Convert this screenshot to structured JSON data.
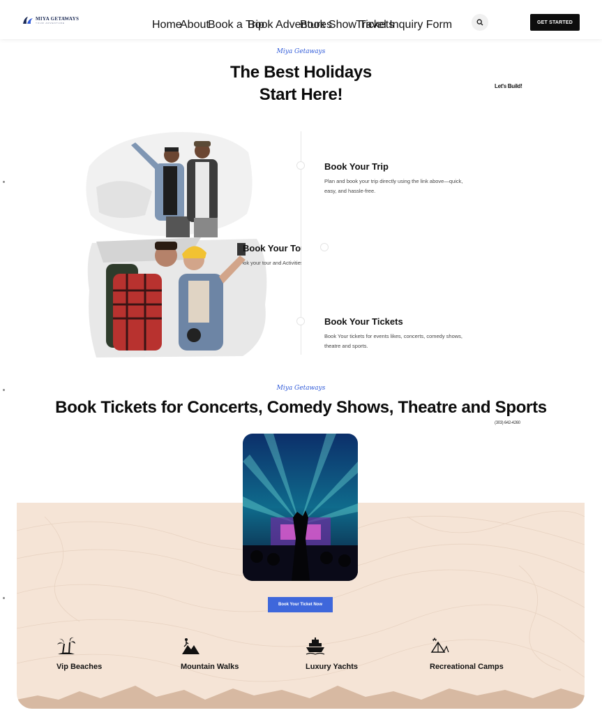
{
  "header": {
    "logo_text": "MIYA GETAWAYS",
    "logo_sub": "YOUR ADVENTURE",
    "nav": [
      "Home",
      "About",
      "Book a Trip",
      "Book Adventures",
      "Book Show Tickets",
      "Travel Inquiry Form"
    ],
    "call_title": "Let's Build!",
    "call_phone": "(303) 642-4260",
    "cta_label": "GET STARTED",
    "search_icon": "search-icon"
  },
  "hero": {
    "script": "Miya Getaways",
    "title_line1": "The Best Holidays",
    "title_line2": "Start Here!",
    "steps": [
      {
        "title": "Book Your Trip",
        "text": "Plan and book your trip directly using the link above—quick, easy, and hassle-free."
      },
      {
        "title": "Book Your Tour",
        "text": "Book your tour and Activities"
      },
      {
        "title": "Book Your Tickets",
        "text": "Book Your tickets for events likes, concerts, comedy shows, theatre and sports."
      }
    ]
  },
  "tickets": {
    "script": "Miya Getaways",
    "title": "Book Tickets for Concerts, Comedy Shows, Theatre and Sports",
    "button": "Book Your Ticket Now"
  },
  "features": [
    {
      "label": "Vip Beaches",
      "icon": "palm-tree-icon"
    },
    {
      "label": "Mountain Walks",
      "icon": "mountain-hiker-icon"
    },
    {
      "label": "Luxury Yachts",
      "icon": "yacht-icon"
    },
    {
      "label": "Recreational Camps",
      "icon": "tent-camp-icon"
    }
  ],
  "colors": {
    "accent_blue": "#3e67db",
    "script_blue": "#2f5ad8",
    "beige": "#f5e4d6",
    "mountain": "#d7b9a2",
    "dark": "#0d0d0d"
  }
}
